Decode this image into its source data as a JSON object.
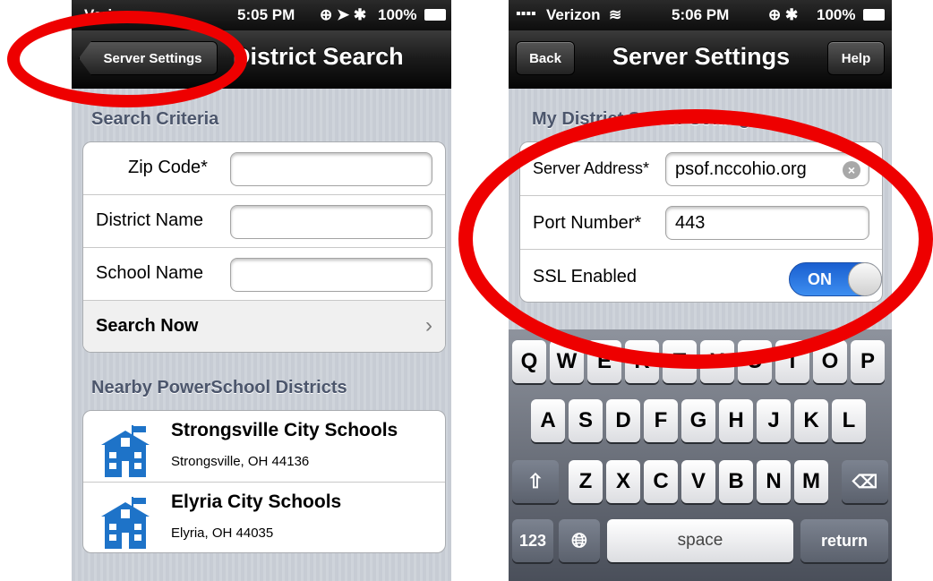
{
  "left": {
    "status": {
      "carrier": "Verizon",
      "time": "5:05 PM",
      "battery": "100%"
    },
    "nav": {
      "back_label": "Server Settings",
      "title": "District Search"
    },
    "search_header": "Search Criteria",
    "fields": [
      {
        "label": "Zip Code*",
        "value": ""
      },
      {
        "label": "District Name",
        "value": ""
      },
      {
        "label": "School Name",
        "value": ""
      }
    ],
    "search_now": "Search Now",
    "nearby_header": "Nearby PowerSchool Districts",
    "districts": [
      {
        "name": "Strongsville City Schools",
        "location": "Strongsville, OH 44136"
      },
      {
        "name": "Elyria City Schools",
        "location": "Elyria, OH 44035"
      }
    ]
  },
  "right": {
    "status": {
      "carrier": "Verizon",
      "time": "5:06 PM",
      "battery": "100%"
    },
    "nav": {
      "back_label": "Back",
      "title": "Server Settings",
      "help_label": "Help"
    },
    "section_header": "My District Server Settings",
    "server_address": {
      "label": "Server Address*",
      "value": "psof.nccohio.org"
    },
    "port_number": {
      "label": "Port Number*",
      "value": "443"
    },
    "ssl": {
      "label": "SSL Enabled",
      "state": "ON"
    },
    "keyboard": {
      "row1": [
        "Q",
        "W",
        "E",
        "R",
        "T",
        "Y",
        "U",
        "I",
        "O",
        "P"
      ],
      "row2": [
        "A",
        "S",
        "D",
        "F",
        "G",
        "H",
        "J",
        "K",
        "L"
      ],
      "row3": [
        "Z",
        "X",
        "C",
        "V",
        "B",
        "N",
        "M"
      ],
      "numbers_label": "123",
      "space_label": "space",
      "return_label": "return"
    }
  },
  "colors": {
    "highlight": "#ee0000",
    "toggle_on": "#2f7de8",
    "section_header": "#4c566c"
  }
}
